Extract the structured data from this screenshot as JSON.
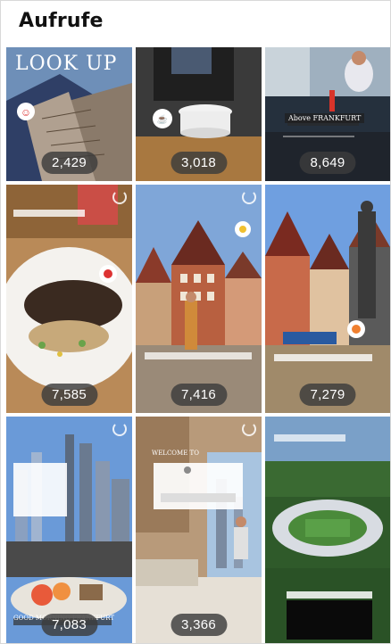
{
  "header": {
    "title": "Aufrufe"
  },
  "tiles": [
    {
      "views": "2,429",
      "overlay": "LOOK UP"
    },
    {
      "views": "3,018"
    },
    {
      "views": "8,649",
      "overlay": "Above FRANKFURT"
    },
    {
      "views": "7,585"
    },
    {
      "views": "7,416"
    },
    {
      "views": "7,279"
    },
    {
      "views": "7,083",
      "overlay": "GOOD MORNING FRANKFURT"
    },
    {
      "views": "3,366",
      "overlay": "WELCOME TO"
    },
    {
      "views": ""
    }
  ],
  "colors": {
    "background": "#ffffff",
    "badge": "#3c3c3c",
    "title": "#111111"
  }
}
